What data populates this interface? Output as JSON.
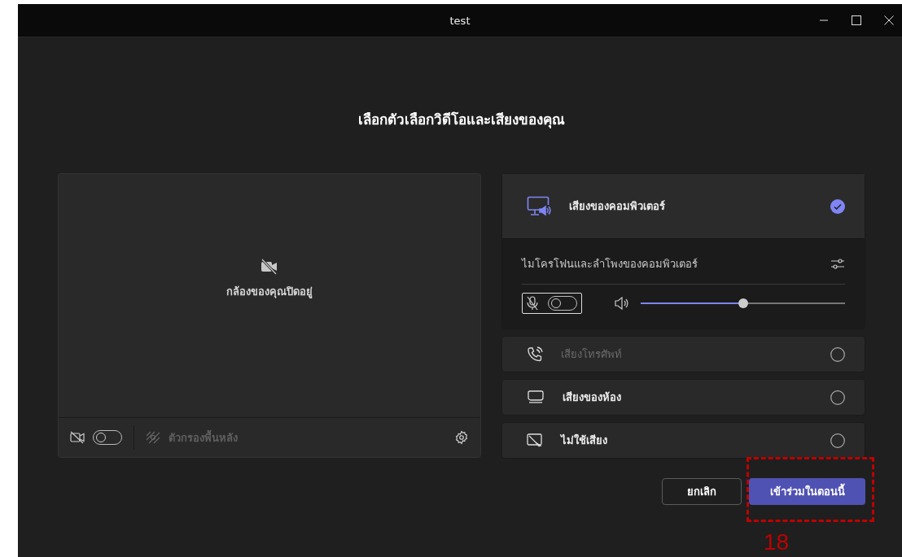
{
  "window": {
    "title": "test"
  },
  "heading": "เลือกตัวเลือกวิดีโอและเสียงของคุณ",
  "video": {
    "message": "กล้องของคุณปิดอยู่",
    "camera_on": false,
    "filter_label": "ตัวกรองพื้นหลัง",
    "filter_disabled": true
  },
  "audio_options": [
    {
      "kind": "computer",
      "label": "เสียงของคอมพิวเตอร์",
      "selected": true,
      "disabled": false,
      "expanded": true,
      "device_label": "ไมโครโฟนและลำโพงของคอมพิวเตอร์",
      "mic_on": false,
      "level": 0.5
    },
    {
      "kind": "phone",
      "label": "เสียงโทรศัพท์",
      "selected": false,
      "disabled": true
    },
    {
      "kind": "room",
      "label": "เสียงของห้อง",
      "selected": false,
      "disabled": false
    },
    {
      "kind": "none",
      "label": "ไม่ใช้เสียง",
      "selected": false,
      "disabled": false
    }
  ],
  "buttons": [
    {
      "kind": "secondary",
      "label": "ยกเลิก"
    },
    {
      "kind": "primary",
      "label": "เข้าร่วมในตอนนี้"
    }
  ],
  "annotation": {
    "label": "18"
  }
}
